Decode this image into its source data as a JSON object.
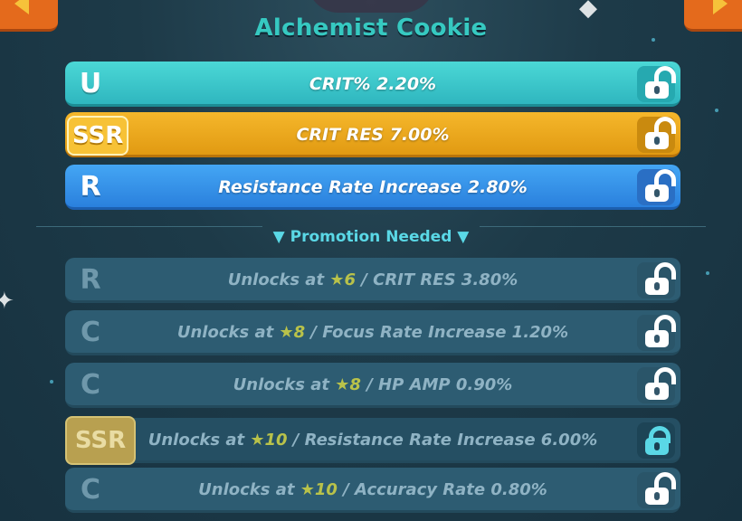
{
  "title": "Alchemist Cookie",
  "colors": {
    "accent": "#36c9c1",
    "uncommon": "#3cc8cc",
    "ssr": "#f0aa1d",
    "rare": "#3591ea",
    "locked": "#2d5c72"
  },
  "unlocked_stats": [
    {
      "grade": "U",
      "text": "CRIT% 2.20%",
      "lock_icon": "unlocked-padlock-icon"
    },
    {
      "grade": "SSR",
      "text": "CRIT RES 7.00%",
      "lock_icon": "unlocked-padlock-icon"
    },
    {
      "grade": "R",
      "text": "Resistance Rate Increase 2.80%",
      "lock_icon": "unlocked-padlock-icon"
    }
  ],
  "promotion_label": "▼ Promotion Needed ▼",
  "locked_stats": [
    {
      "grade": "R",
      "prefix": "Unlocks at ",
      "star": "★6",
      "suffix": " / CRIT RES 3.80%",
      "lock_icon": "unlocked-padlock-icon"
    },
    {
      "grade": "C",
      "prefix": "Unlocks at ",
      "star": "★8",
      "suffix": " / Focus Rate Increase 1.20%",
      "lock_icon": "unlocked-padlock-icon"
    },
    {
      "grade": "C",
      "prefix": "Unlocks at ",
      "star": "★8",
      "suffix": " / HP AMP 0.90%",
      "lock_icon": "unlocked-padlock-icon"
    },
    {
      "grade": "SSR",
      "prefix": "Unlocks at ",
      "star": "★10",
      "suffix": " / Resistance Rate Increase 6.00%",
      "lock_icon": "locked-padlock-icon"
    },
    {
      "grade": "C",
      "prefix": "Unlocks at ",
      "star": "★10",
      "suffix": " / Accuracy Rate 0.80%",
      "lock_icon": "unlocked-padlock-icon"
    }
  ]
}
